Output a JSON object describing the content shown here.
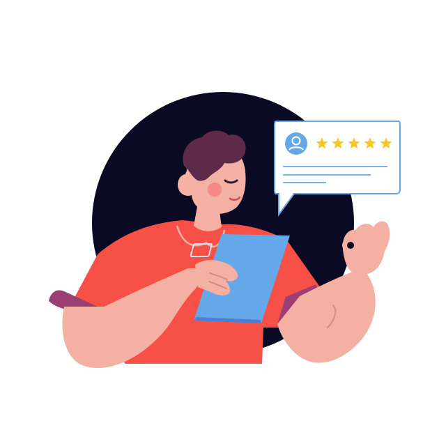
{
  "illustration": {
    "background_color": "#ffffff",
    "backdrop_circle_color": "#0b0a24",
    "shirt_color": "#f75046",
    "sleeve_color": "#9b3f73",
    "skin_color": "#f4b0a3",
    "skin_line_color": "#d98a80",
    "hair_color": "#5e2a4a",
    "tablet_color": "#65a8ea",
    "tablet_edge_color": "#4a7fd2",
    "review_card": {
      "border_color": "#65a8ea",
      "fill_color": "#ffffff",
      "avatar_color": "#65a8ea",
      "avatar_icon": "user-avatar-icon",
      "star_icon": "star-icon",
      "star_color": "#f7c729",
      "rating": 5,
      "max_rating": 5,
      "line_color": "#65a8ea"
    }
  }
}
